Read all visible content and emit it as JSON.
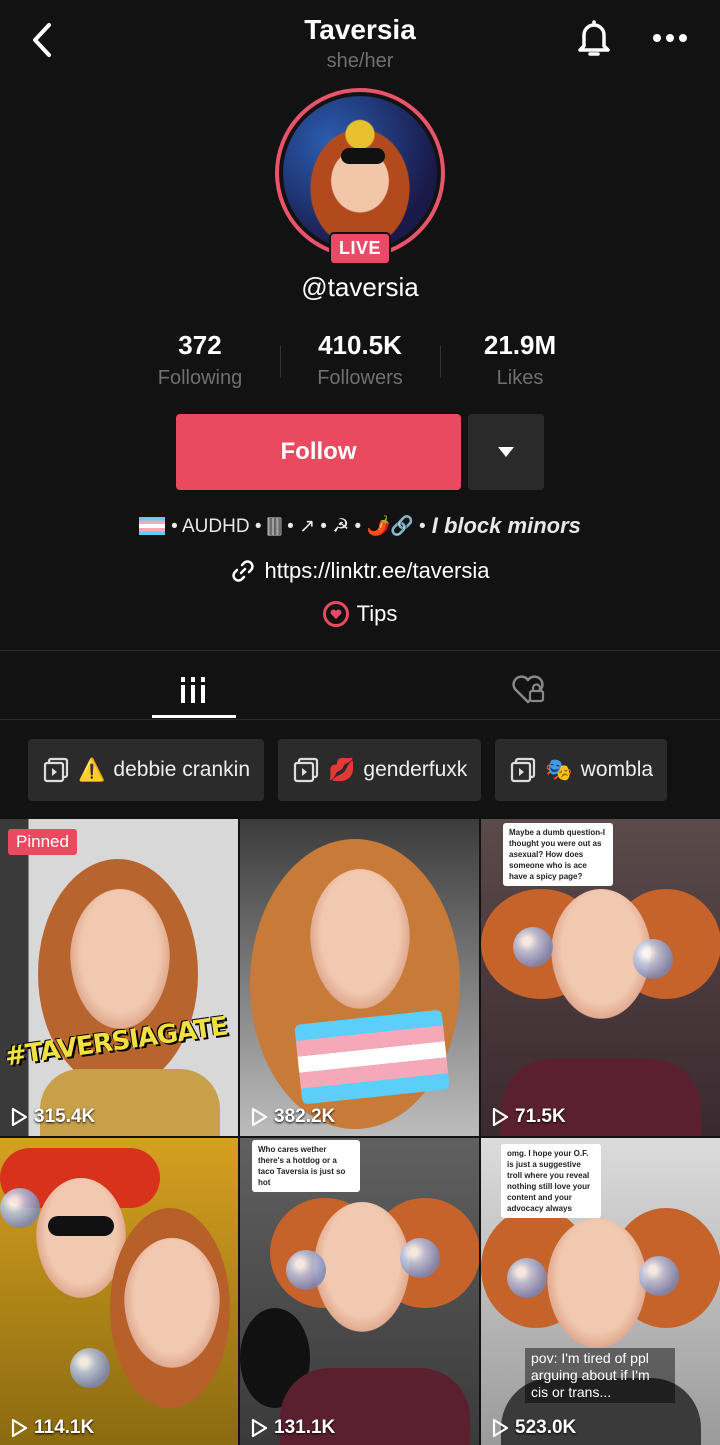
{
  "header": {
    "title": "Taversia",
    "pronouns": "she/her"
  },
  "profile": {
    "live_label": "LIVE",
    "handle": "@taversia",
    "stats": [
      {
        "value": "372",
        "label": "Following"
      },
      {
        "value": "410.5K",
        "label": "Followers"
      },
      {
        "value": "21.9M",
        "label": "Likes"
      }
    ],
    "follow_label": "Follow",
    "bio_text": "• AUDHD • 🀫 • ↗ • ☭ • 🌶️🔗 •",
    "bio_italic": "I block minors",
    "link": "https://linktr.ee/taversia",
    "tips_label": "Tips"
  },
  "playlists": [
    {
      "emoji": "⚠️",
      "label": "debbie crankin"
    },
    {
      "emoji": "💋",
      "label": "genderfuxk"
    },
    {
      "emoji": "🎭",
      "label": "wombla"
    }
  ],
  "videos": [
    {
      "views": "315.4K",
      "pinned": "Pinned",
      "overlay": "#TAVERSIAGATE"
    },
    {
      "views": "382.2K"
    },
    {
      "views": "71.5K",
      "caption": "Maybe a dumb question-I thought you were out as asexual? How does someone who is ace have a spicy page?"
    },
    {
      "views": "114.1K"
    },
    {
      "views": "131.1K",
      "caption": "Who cares wether there's a hotdog or a taco Taversia is just so hot"
    },
    {
      "views": "523.0K",
      "caption": "omg. I hope your O.F. is just a suggestive troll where you reveal nothing still love your content and your advocacy always",
      "overlay": "pov: I'm tired of ppl arguing about if I'm cis or trans..."
    }
  ],
  "colors": {
    "background": "#121212",
    "accent": "#ea4a5f",
    "muted_text": "#6f6f6f"
  }
}
